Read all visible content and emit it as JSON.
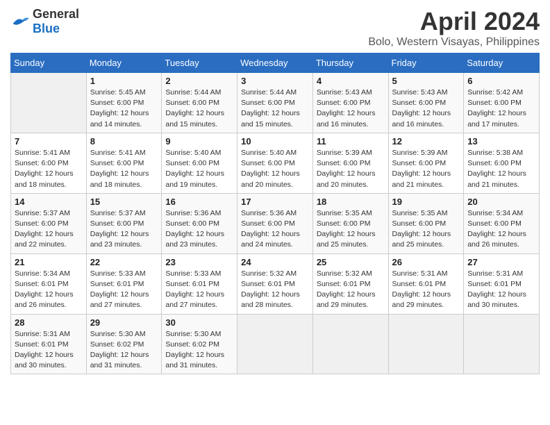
{
  "logo": {
    "general": "General",
    "blue": "Blue"
  },
  "title": "April 2024",
  "location": "Bolo, Western Visayas, Philippines",
  "days_of_week": [
    "Sunday",
    "Monday",
    "Tuesday",
    "Wednesday",
    "Thursday",
    "Friday",
    "Saturday"
  ],
  "weeks": [
    [
      {
        "day": "",
        "info": ""
      },
      {
        "day": "1",
        "info": "Sunrise: 5:45 AM\nSunset: 6:00 PM\nDaylight: 12 hours\nand 14 minutes."
      },
      {
        "day": "2",
        "info": "Sunrise: 5:44 AM\nSunset: 6:00 PM\nDaylight: 12 hours\nand 15 minutes."
      },
      {
        "day": "3",
        "info": "Sunrise: 5:44 AM\nSunset: 6:00 PM\nDaylight: 12 hours\nand 15 minutes."
      },
      {
        "day": "4",
        "info": "Sunrise: 5:43 AM\nSunset: 6:00 PM\nDaylight: 12 hours\nand 16 minutes."
      },
      {
        "day": "5",
        "info": "Sunrise: 5:43 AM\nSunset: 6:00 PM\nDaylight: 12 hours\nand 16 minutes."
      },
      {
        "day": "6",
        "info": "Sunrise: 5:42 AM\nSunset: 6:00 PM\nDaylight: 12 hours\nand 17 minutes."
      }
    ],
    [
      {
        "day": "7",
        "info": "Sunrise: 5:41 AM\nSunset: 6:00 PM\nDaylight: 12 hours\nand 18 minutes."
      },
      {
        "day": "8",
        "info": "Sunrise: 5:41 AM\nSunset: 6:00 PM\nDaylight: 12 hours\nand 18 minutes."
      },
      {
        "day": "9",
        "info": "Sunrise: 5:40 AM\nSunset: 6:00 PM\nDaylight: 12 hours\nand 19 minutes."
      },
      {
        "day": "10",
        "info": "Sunrise: 5:40 AM\nSunset: 6:00 PM\nDaylight: 12 hours\nand 20 minutes."
      },
      {
        "day": "11",
        "info": "Sunrise: 5:39 AM\nSunset: 6:00 PM\nDaylight: 12 hours\nand 20 minutes."
      },
      {
        "day": "12",
        "info": "Sunrise: 5:39 AM\nSunset: 6:00 PM\nDaylight: 12 hours\nand 21 minutes."
      },
      {
        "day": "13",
        "info": "Sunrise: 5:38 AM\nSunset: 6:00 PM\nDaylight: 12 hours\nand 21 minutes."
      }
    ],
    [
      {
        "day": "14",
        "info": "Sunrise: 5:37 AM\nSunset: 6:00 PM\nDaylight: 12 hours\nand 22 minutes."
      },
      {
        "day": "15",
        "info": "Sunrise: 5:37 AM\nSunset: 6:00 PM\nDaylight: 12 hours\nand 23 minutes."
      },
      {
        "day": "16",
        "info": "Sunrise: 5:36 AM\nSunset: 6:00 PM\nDaylight: 12 hours\nand 23 minutes."
      },
      {
        "day": "17",
        "info": "Sunrise: 5:36 AM\nSunset: 6:00 PM\nDaylight: 12 hours\nand 24 minutes."
      },
      {
        "day": "18",
        "info": "Sunrise: 5:35 AM\nSunset: 6:00 PM\nDaylight: 12 hours\nand 25 minutes."
      },
      {
        "day": "19",
        "info": "Sunrise: 5:35 AM\nSunset: 6:00 PM\nDaylight: 12 hours\nand 25 minutes."
      },
      {
        "day": "20",
        "info": "Sunrise: 5:34 AM\nSunset: 6:00 PM\nDaylight: 12 hours\nand 26 minutes."
      }
    ],
    [
      {
        "day": "21",
        "info": "Sunrise: 5:34 AM\nSunset: 6:01 PM\nDaylight: 12 hours\nand 26 minutes."
      },
      {
        "day": "22",
        "info": "Sunrise: 5:33 AM\nSunset: 6:01 PM\nDaylight: 12 hours\nand 27 minutes."
      },
      {
        "day": "23",
        "info": "Sunrise: 5:33 AM\nSunset: 6:01 PM\nDaylight: 12 hours\nand 27 minutes."
      },
      {
        "day": "24",
        "info": "Sunrise: 5:32 AM\nSunset: 6:01 PM\nDaylight: 12 hours\nand 28 minutes."
      },
      {
        "day": "25",
        "info": "Sunrise: 5:32 AM\nSunset: 6:01 PM\nDaylight: 12 hours\nand 29 minutes."
      },
      {
        "day": "26",
        "info": "Sunrise: 5:31 AM\nSunset: 6:01 PM\nDaylight: 12 hours\nand 29 minutes."
      },
      {
        "day": "27",
        "info": "Sunrise: 5:31 AM\nSunset: 6:01 PM\nDaylight: 12 hours\nand 30 minutes."
      }
    ],
    [
      {
        "day": "28",
        "info": "Sunrise: 5:31 AM\nSunset: 6:01 PM\nDaylight: 12 hours\nand 30 minutes."
      },
      {
        "day": "29",
        "info": "Sunrise: 5:30 AM\nSunset: 6:02 PM\nDaylight: 12 hours\nand 31 minutes."
      },
      {
        "day": "30",
        "info": "Sunrise: 5:30 AM\nSunset: 6:02 PM\nDaylight: 12 hours\nand 31 minutes."
      },
      {
        "day": "",
        "info": ""
      },
      {
        "day": "",
        "info": ""
      },
      {
        "day": "",
        "info": ""
      },
      {
        "day": "",
        "info": ""
      }
    ]
  ]
}
